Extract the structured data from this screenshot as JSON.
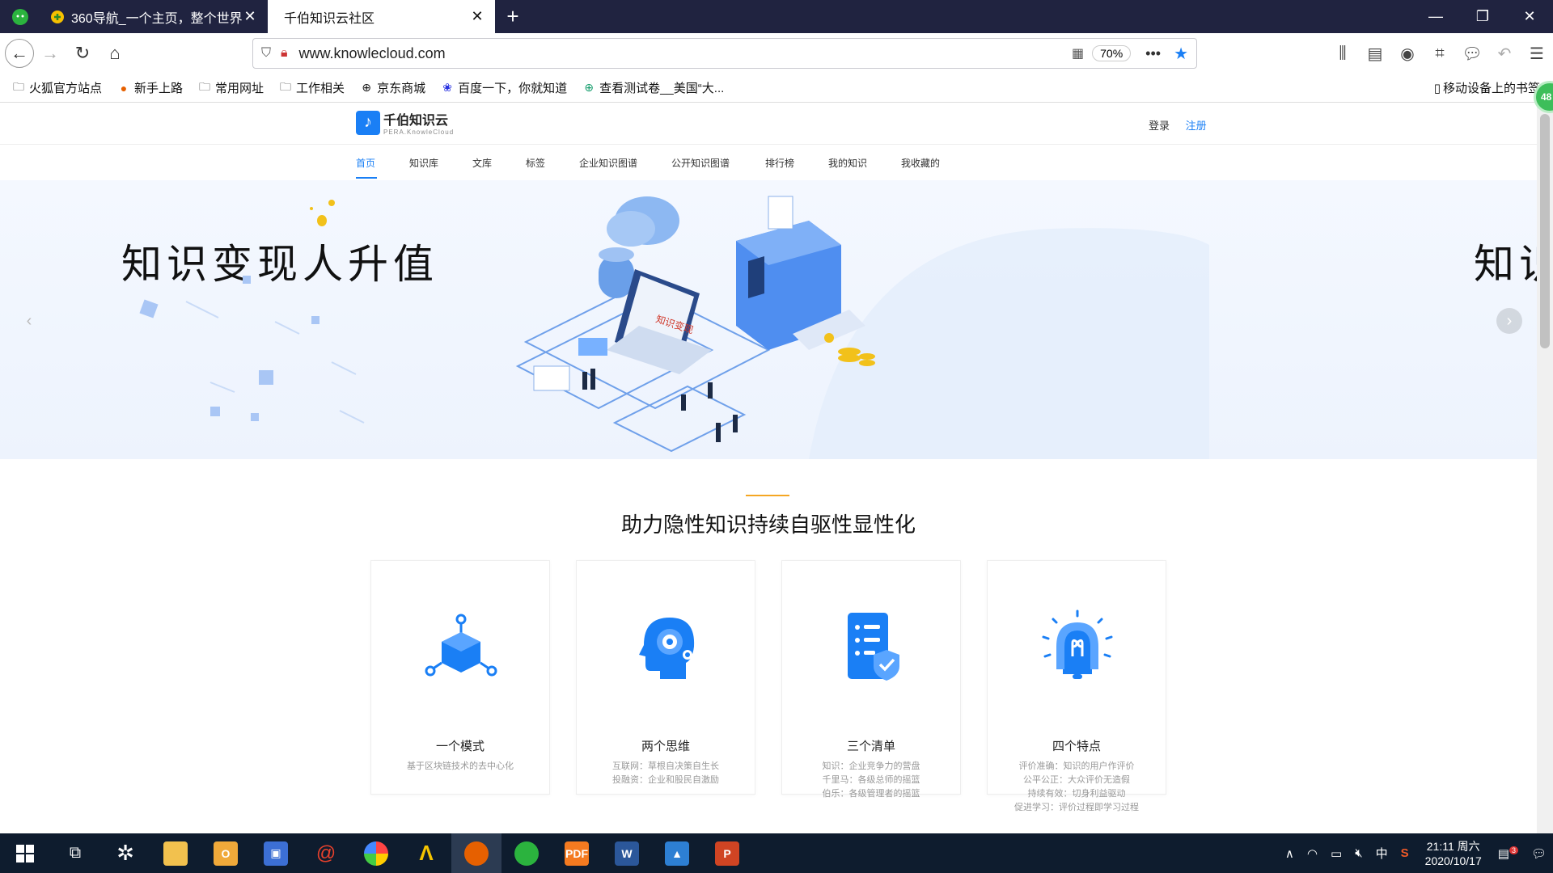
{
  "browser": {
    "tabs": [
      {
        "title": "360导航_一个主页，整个世界"
      },
      {
        "title": "千伯知识云社区"
      }
    ],
    "url": "www.knowlecloud.com",
    "zoom": "70%",
    "bookmarks": [
      "火狐官方站点",
      "新手上路",
      "常用网址",
      "工作相关",
      "京东商城",
      "百度一下，你就知道",
      "查看测试卷__美国“大..."
    ],
    "bookmarks_right": "移动设备上的书签",
    "badge_count": "48"
  },
  "site": {
    "logo_cn": "千伯知识云",
    "logo_en": "PERA.KnowleCloud",
    "login": "登录",
    "register": "注册",
    "nav": [
      "首页",
      "知识库",
      "文库",
      "标签",
      "企业知识图谱",
      "公开知识图谱",
      "排行榜",
      "我的知识",
      "我收藏的"
    ],
    "banner_title": "知识变现人升值",
    "banner_next_title": "知识",
    "section_title": "助力隐性知识持续自驱性显性化",
    "cards": [
      {
        "title": "一个模式",
        "icon": "cube-network-icon",
        "desc": [
          "基于区块链技术的去中心化"
        ]
      },
      {
        "title": "两个思维",
        "icon": "head-gear-icon",
        "desc": [
          "互联网：草根自决策自生长",
          "投融资：企业和股民自激励"
        ]
      },
      {
        "title": "三个清单",
        "icon": "checklist-icon",
        "desc": [
          "知识：企业竞争力的营盘",
          "千里马：各级总师的摇篮",
          "伯乐：各级管理者的摇篮"
        ]
      },
      {
        "title": "四个特点",
        "icon": "lightbulb-icon",
        "desc": [
          "评价准确：知识的用户作评价",
          "公平公正：大众评价无造假",
          "持续有效：切身利益驱动",
          "促进学习：评价过程即学习过程"
        ]
      }
    ]
  },
  "taskbar": {
    "time": "21:11 周六",
    "date": "2020/10/17",
    "ime": "中",
    "notif_count": "3"
  },
  "colors": {
    "accent": "#1a7ff5",
    "highlight": "#f5a623",
    "tabbar": "#202340",
    "taskbar": "#0e1c2e"
  }
}
